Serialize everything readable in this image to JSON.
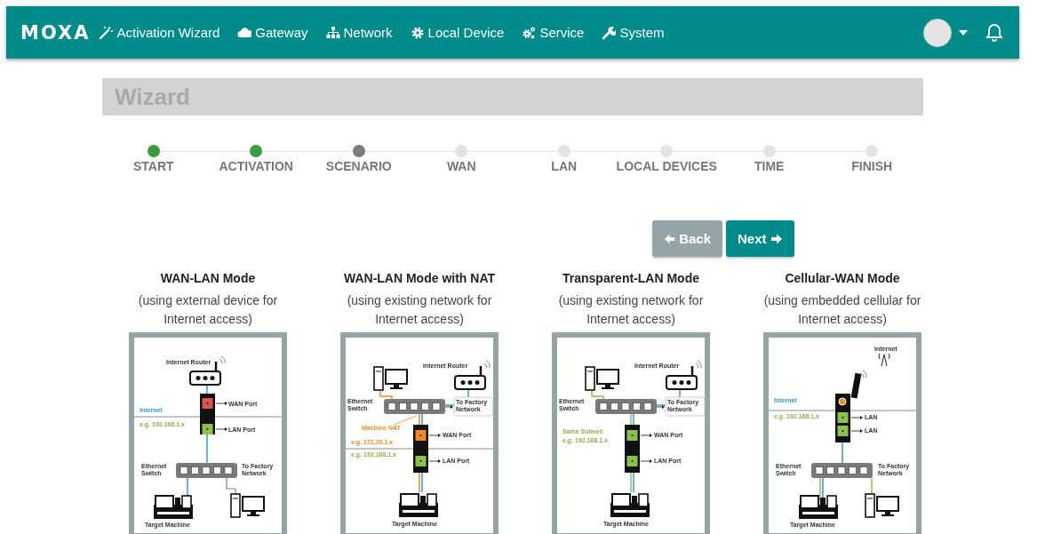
{
  "nav": {
    "logo": "MOXA",
    "items": [
      {
        "label": "Activation Wizard",
        "kind": "wand"
      },
      {
        "label": "Gateway",
        "kind": "cloud"
      },
      {
        "label": "Network",
        "kind": "sitemap"
      },
      {
        "label": "Local Device",
        "kind": "gear"
      },
      {
        "label": "Service",
        "kind": "gears"
      },
      {
        "label": "System",
        "kind": "wrench"
      }
    ]
  },
  "wizard": {
    "title": "Wizard"
  },
  "steps": [
    {
      "label": "START",
      "completed": true,
      "selected": false
    },
    {
      "label": "ACTIVATION",
      "completed": true,
      "selected": false
    },
    {
      "label": "SCENARIO",
      "completed": false,
      "selected": true
    },
    {
      "label": "WAN",
      "completed": false,
      "selected": false
    },
    {
      "label": "LAN",
      "completed": false,
      "selected": false
    },
    {
      "label": "LOCAL DEVICES",
      "completed": false,
      "selected": false
    },
    {
      "label": "TIME",
      "completed": false,
      "selected": false
    },
    {
      "label": "FINISH",
      "completed": false,
      "selected": false
    }
  ],
  "buttons": [
    {
      "label": "Back",
      "kind": "back"
    },
    {
      "label": "Next",
      "kind": "next"
    }
  ],
  "modes": [
    {
      "title": "WAN-LAN Mode",
      "subtitle": "(using external device for Internet access)",
      "kind": "wan-lan",
      "labels": [
        {
          "text": "Internet Router",
          "color": "#333333"
        },
        {
          "text": "WAN Port",
          "color": "#333333"
        },
        {
          "text": "LAN Port",
          "color": "#333333"
        },
        {
          "text": "Internet",
          "color": "#3399dd"
        },
        {
          "text": "e.g. 192.168.1.x",
          "color": "#8bb04a"
        },
        {
          "text": "Ethernet Switch",
          "color": "#333333"
        },
        {
          "text": "To Factory Network",
          "color": "#333333"
        },
        {
          "text": "Target Machine",
          "color": "#333333"
        }
      ]
    },
    {
      "title": "WAN-LAN Mode with NAT",
      "subtitle": "(using existing network for Internet access)",
      "kind": "nat",
      "labels": [
        {
          "text": "Internet Router",
          "color": "#333333"
        },
        {
          "text": "Ethernet Switch",
          "color": "#333333"
        },
        {
          "text": "To Factory Network",
          "color": "#333333"
        },
        {
          "text": "Machine NAT",
          "color": "#f08a24"
        },
        {
          "text": "e.g. 172.20.1.x",
          "color": "#f08a24"
        },
        {
          "text": "e.g. 192.168.1.x",
          "color": "#8bb04a"
        },
        {
          "text": "WAN Port",
          "color": "#333333"
        },
        {
          "text": "LAN Port",
          "color": "#333333"
        },
        {
          "text": "Target Machine",
          "color": "#333333"
        }
      ]
    },
    {
      "title": "Transparent-LAN Mode",
      "subtitle": "(using existing network for Internet access)",
      "kind": "transparent",
      "labels": [
        {
          "text": "Internet Router",
          "color": "#333333"
        },
        {
          "text": "Ethernet Switch",
          "color": "#333333"
        },
        {
          "text": "To Factory Network",
          "color": "#333333"
        },
        {
          "text": "Same Subnet:",
          "color": "#8bb04a"
        },
        {
          "text": "e.g. 192.168.1.x",
          "color": "#8bb04a"
        },
        {
          "text": "WAN Port",
          "color": "#333333"
        },
        {
          "text": "LAN Port",
          "color": "#333333"
        },
        {
          "text": "Target Machine",
          "color": "#333333"
        }
      ]
    },
    {
      "title": "Cellular-WAN Mode",
      "subtitle": "(using embedded cellular for Internet access)",
      "kind": "cellular",
      "labels": [
        {
          "text": "Internet",
          "color": "#333333"
        },
        {
          "text": "Internet",
          "color": "#3399dd"
        },
        {
          "text": "e.g. 192.168.1.x",
          "color": "#8bb04a"
        },
        {
          "text": "LAN",
          "color": "#333333"
        },
        {
          "text": "LAN",
          "color": "#333333"
        },
        {
          "text": "Ethernet Switch",
          "color": "#333333"
        },
        {
          "text": "To Factory Network",
          "color": "#333333"
        },
        {
          "text": "Target Machine",
          "color": "#333333"
        }
      ]
    }
  ]
}
